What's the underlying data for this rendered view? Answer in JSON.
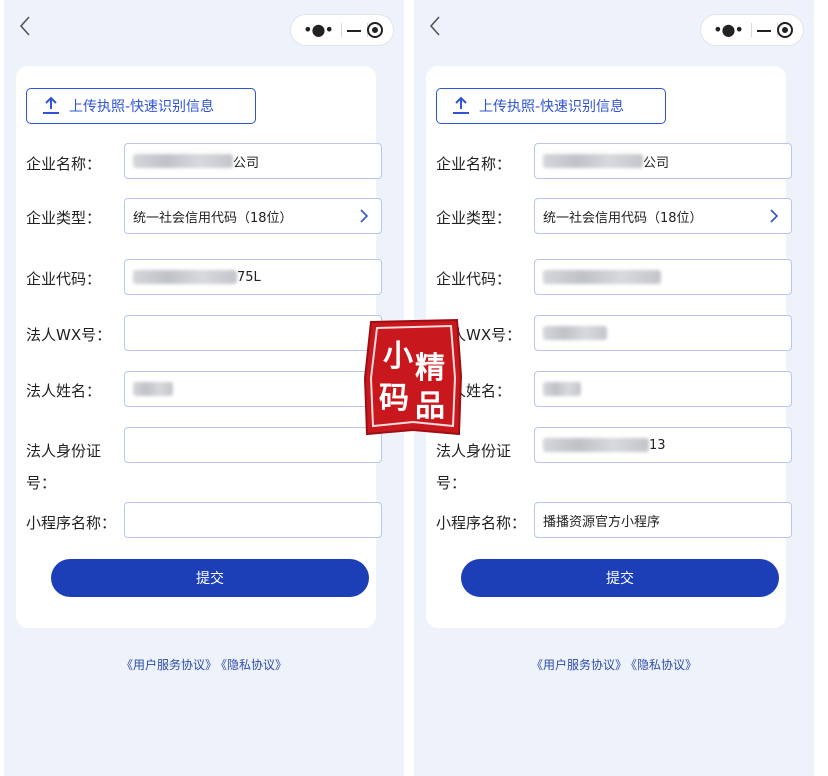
{
  "colors": {
    "accent": "#1c3fb8",
    "page_bg": "#eef3fb",
    "input_border": "#b9c6ee",
    "seal": "#c8171d"
  },
  "nav": {
    "back_icon": "chevron-left-icon",
    "menu_glyph": "•●•"
  },
  "left": {
    "upload_label": "上传执照-快速识别信息",
    "fields": [
      {
        "label": "企业名称：",
        "value": "公司"
      },
      {
        "label": "企业类型：",
        "value": "统一社会信用代码（18位）"
      },
      {
        "label": "企业代码：",
        "value": "75L"
      },
      {
        "label": "法人WX号：",
        "value": ""
      },
      {
        "label": "法人姓名：",
        "value": ""
      },
      {
        "label": "法人身份证",
        "label2": "号：",
        "value": ""
      },
      {
        "label": "小程序名称：",
        "value": ""
      }
    ],
    "submit_label": "提交",
    "link_user": "《用户服务协议》",
    "link_privacy": "《隐私协议》"
  },
  "right": {
    "upload_label": "上传执照-快速识别信息",
    "fields": [
      {
        "label": "企业名称：",
        "value": "公司"
      },
      {
        "label": "企业类型：",
        "value": "统一社会信用代码（18位）"
      },
      {
        "label": "企业代码：",
        "value": ""
      },
      {
        "label": "法人WX号：",
        "value": ""
      },
      {
        "label": "法人姓名：",
        "value": ""
      },
      {
        "label": "法人身份证",
        "label2": "号：",
        "value": "13"
      },
      {
        "label": "小程序名称：",
        "value": "播播资源官方小程序"
      }
    ],
    "submit_label": "提交",
    "link_user": "《用户服务协议》",
    "link_privacy": "《隐私协议》"
  },
  "watermark": {
    "chars": [
      "小",
      "精",
      "码",
      "品"
    ]
  }
}
